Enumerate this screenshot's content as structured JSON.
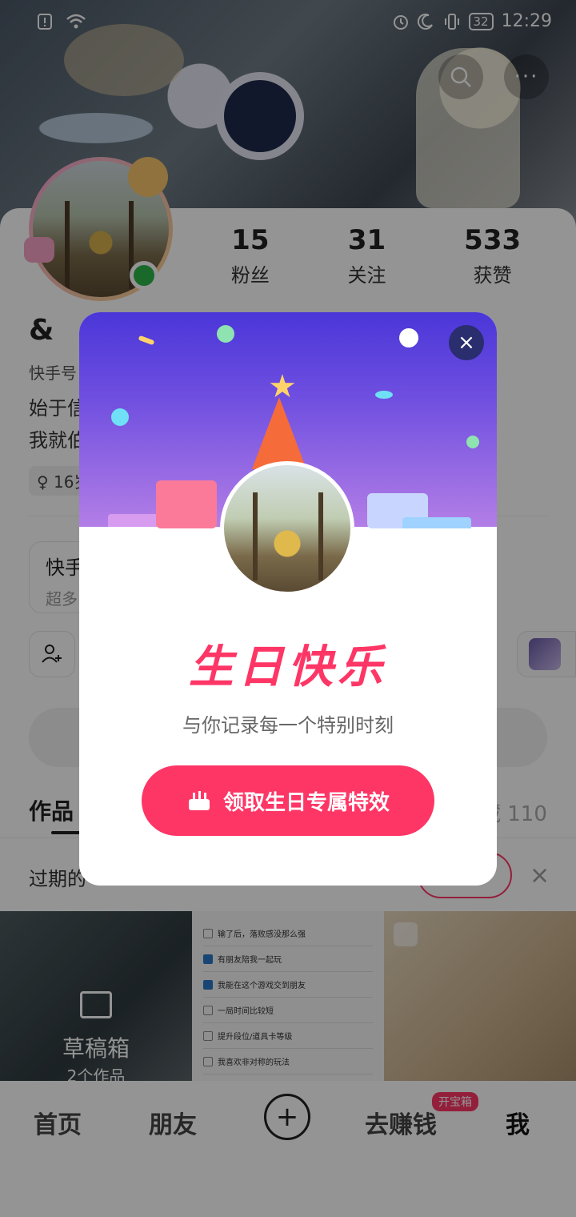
{
  "status_bar": {
    "time": "12:29",
    "battery": "32"
  },
  "profile": {
    "name": "&",
    "kuaishou_id_prefix": "快手号",
    "bio_line1": "始于信",
    "bio_line2": "我就伯",
    "tag": "16岁"
  },
  "stats": [
    {
      "value": "15",
      "label": "粉丝"
    },
    {
      "value": "31",
      "label": "关注"
    },
    {
      "value": "533",
      "label": "获赞"
    }
  ],
  "promo": {
    "title": "快手",
    "subtitle": "超多"
  },
  "tabs": {
    "works": "作品",
    "favorites": "藏 110"
  },
  "notice": {
    "text": "过期的"
  },
  "grid": {
    "draft_title": "草稿箱",
    "draft_count": "2个作品",
    "quiz_items": [
      {
        "text": "输了后，落败感没那么强",
        "checked": false
      },
      {
        "text": "有朋友陪我一起玩",
        "checked": true
      },
      {
        "text": "我能在这个游戏交到朋友",
        "checked": true
      },
      {
        "text": "一局时间比较短",
        "checked": false
      },
      {
        "text": "提升段位/道具卡等级",
        "checked": false
      },
      {
        "text": "我喜欢非对称的玩法",
        "checked": false
      }
    ]
  },
  "bottom_nav": {
    "home": "首页",
    "friends": "朋友",
    "earn": "去赚钱",
    "earn_badge": "开宝箱",
    "me": "我"
  },
  "modal": {
    "title": "生日快乐",
    "subtitle": "与你记录每一个特别时刻",
    "button": "领取生日专属特效",
    "close": "×"
  }
}
